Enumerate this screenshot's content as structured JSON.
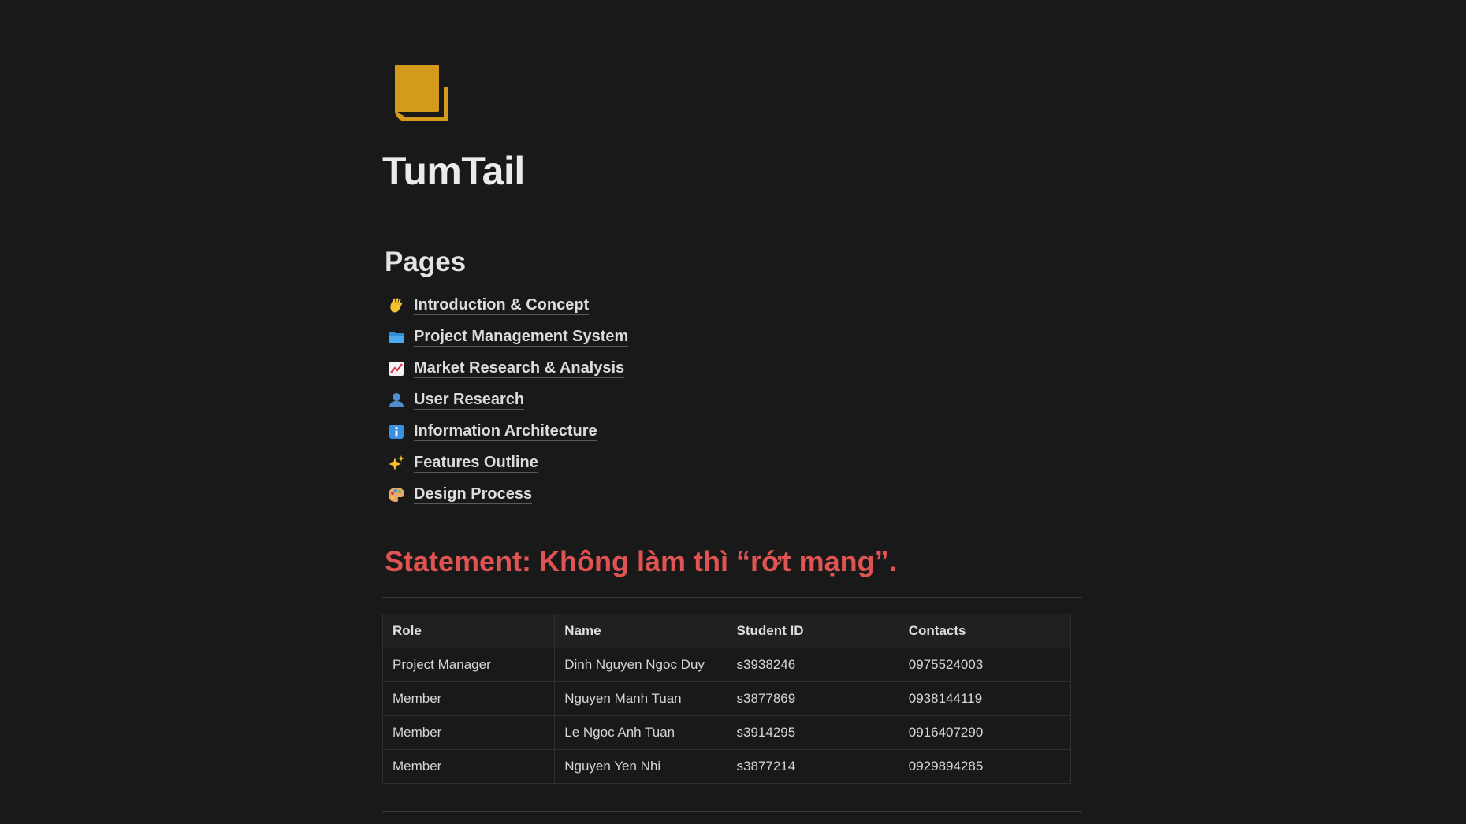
{
  "page": {
    "title": "TumTail",
    "icon": "document-stack-icon",
    "icon_color": "#d49a1c"
  },
  "pages_section": {
    "heading": "Pages",
    "items": [
      {
        "icon": "waving-hand-icon",
        "label": "Introduction & Concept"
      },
      {
        "icon": "folder-icon",
        "label": "Project Management System"
      },
      {
        "icon": "chart-increasing-icon",
        "label": "Market Research & Analysis"
      },
      {
        "icon": "person-silhouette-icon",
        "label": "User Research"
      },
      {
        "icon": "information-icon",
        "label": "Information Architecture"
      },
      {
        "icon": "sparkles-icon",
        "label": "Features Outline"
      },
      {
        "icon": "palette-icon",
        "label": "Design Process"
      }
    ]
  },
  "statement": {
    "text": "Statement: Không làm thì “rớt mạng”.",
    "color": "#df5452"
  },
  "team_table": {
    "headers": [
      "Role",
      "Name",
      "Student ID",
      "Contacts"
    ],
    "rows": [
      [
        "Project Manager",
        "Dinh Nguyen Ngoc Duy",
        "s3938246",
        "0975524003"
      ],
      [
        "Member",
        "Nguyen Manh Tuan",
        "s3877869",
        "0938144119"
      ],
      [
        "Member",
        "Le Ngoc Anh Tuan",
        "s3914295",
        "0916407290"
      ],
      [
        "Member",
        "Nguyen Yen Nhi",
        "s3877214",
        "0929894285"
      ]
    ]
  }
}
